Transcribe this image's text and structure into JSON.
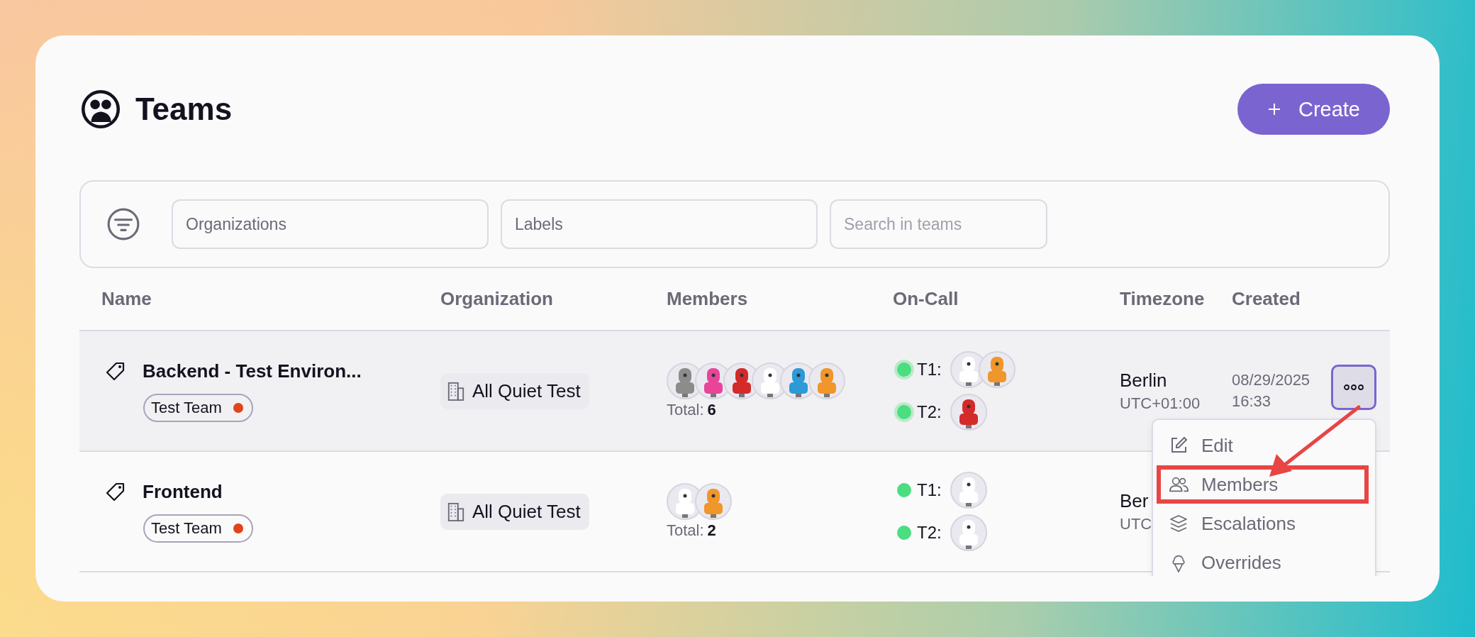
{
  "page": {
    "title": "Teams",
    "create_button": "Create"
  },
  "filters": {
    "organizations": {
      "placeholder": "Organizations"
    },
    "labels": {
      "placeholder": "Labels"
    },
    "search": {
      "placeholder": "Search in teams"
    }
  },
  "table": {
    "columns": [
      "Name",
      "Organization",
      "Members",
      "On-Call",
      "Timezone",
      "Created"
    ],
    "rows": [
      {
        "name": "Backend - Test Environ...",
        "hovered": true,
        "label": {
          "text": "Test Team",
          "color": "#e0441c"
        },
        "organization": "All Quiet Test",
        "members": [
          {
            "color": "#8c8c8c"
          },
          {
            "color": "#e8449a"
          },
          {
            "color": "#d42a2a"
          },
          {
            "color": "#ffffff"
          },
          {
            "color": "#2b9ad6"
          },
          {
            "color": "#f0962a"
          }
        ],
        "total_label": "Total:",
        "total": "6",
        "on_call": [
          {
            "tier": "T1:",
            "color": "#4ade80",
            "avatars": [
              {
                "color": "#ffffff"
              },
              {
                "color": "#f0962a"
              }
            ]
          },
          {
            "tier": "T2:",
            "color": "#4ade80",
            "avatars": [
              {
                "color": "#d42a2a"
              }
            ]
          }
        ],
        "timezone": "Berlin",
        "offset": "UTC+01:00",
        "created_date": "08/29/2025",
        "created_time": "16:33",
        "actions": {
          "open": true
        }
      },
      {
        "name": "Frontend",
        "hovered": false,
        "label": {
          "text": "Test Team",
          "color": "#e0441c"
        },
        "organization": "All Quiet Test",
        "members": [
          {
            "color": "#ffffff"
          },
          {
            "color": "#f0962a"
          }
        ],
        "total_label": "Total:",
        "total": "2",
        "on_call": [
          {
            "tier": "T1:",
            "color": "#4ade80",
            "avatars": [
              {
                "color": "#ffffff"
              }
            ]
          },
          {
            "tier": "T2:",
            "color": "#4ade80",
            "avatars": [
              {
                "color": "#ffffff"
              }
            ]
          }
        ],
        "timezone": "Ber",
        "offset": "UTC"
      }
    ]
  },
  "menu": {
    "items": [
      {
        "label": "Edit",
        "kind": "edit",
        "highlighted": false
      },
      {
        "label": "Members",
        "kind": "members",
        "highlighted": true
      },
      {
        "label": "Escalations",
        "kind": "escalations",
        "highlighted": false
      },
      {
        "label": "Overrides",
        "kind": "overrides",
        "highlighted": false
      }
    ]
  }
}
